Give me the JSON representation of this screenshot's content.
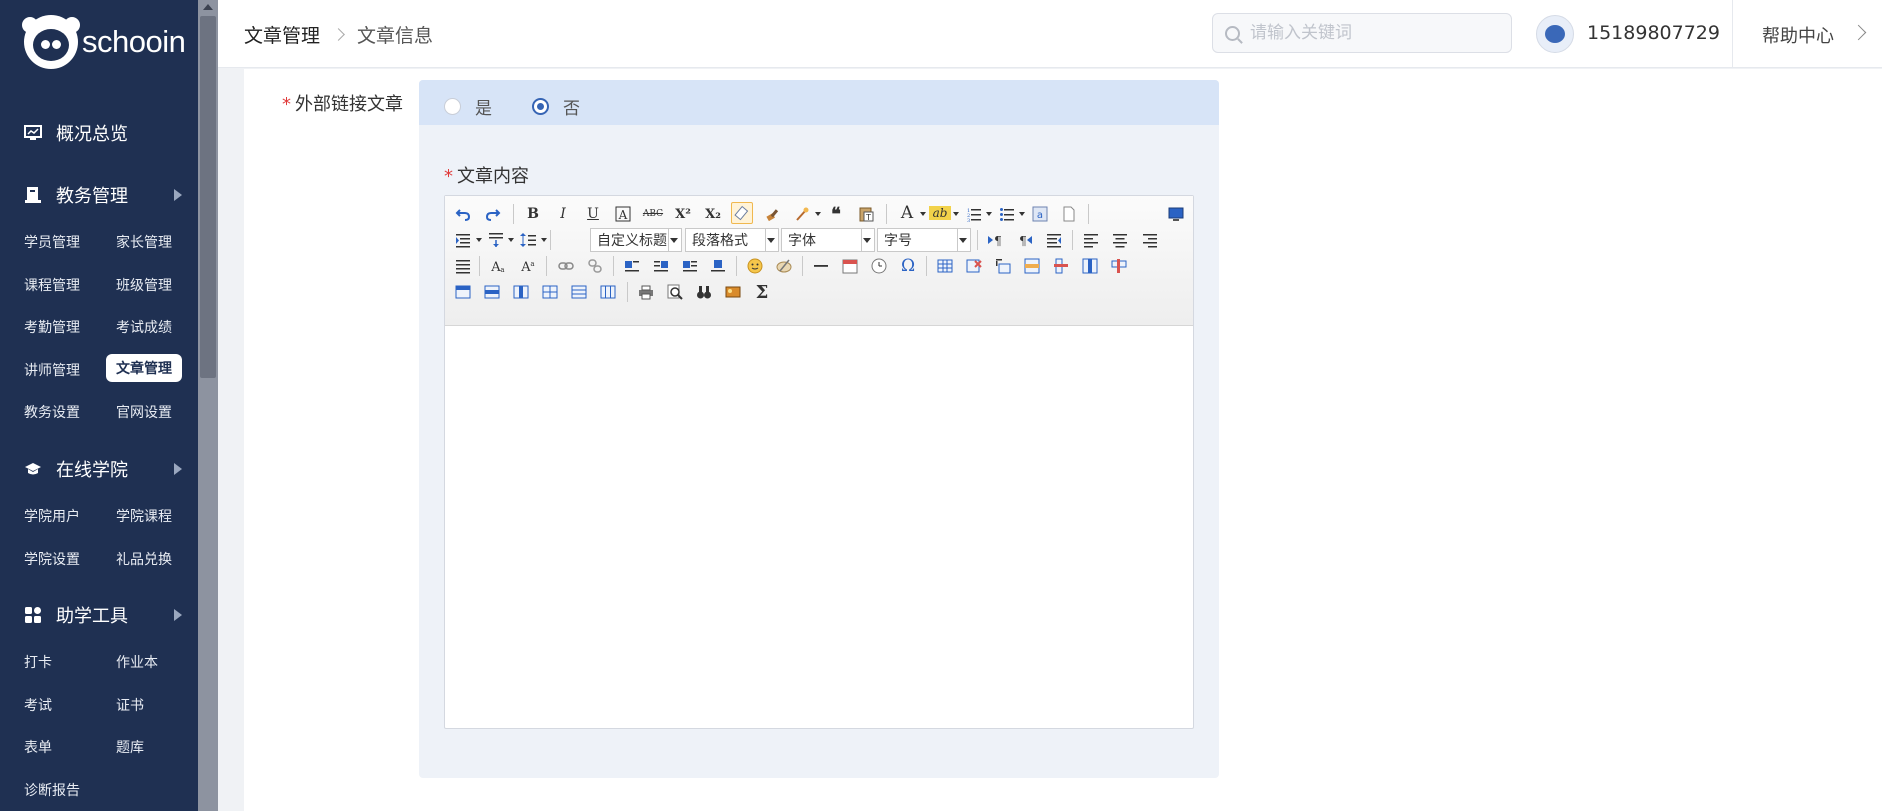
{
  "brand": {
    "name": "schooin"
  },
  "sidebar": {
    "sections": [
      {
        "label": "概况总览",
        "icon": "dashboard-icon"
      },
      {
        "label": "教务管理",
        "icon": "book-icon"
      },
      {
        "label": "在线学院",
        "icon": "graduation-cap-icon"
      },
      {
        "label": "助学工具",
        "icon": "grid-icon"
      }
    ],
    "edu_items": [
      "学员管理",
      "家长管理",
      "课程管理",
      "班级管理",
      "考勤管理",
      "考试成绩",
      "讲师管理",
      "文章管理",
      "教务设置",
      "官网设置"
    ],
    "academy_items": [
      "学院用户",
      "学院课程",
      "学院设置",
      "礼品兑换"
    ],
    "tool_items": [
      "打卡",
      "作业本",
      "考试",
      "证书",
      "表单",
      "题库",
      "诊断报告"
    ],
    "active_item": "文章管理"
  },
  "header": {
    "breadcrumb": [
      "文章管理",
      "文章信息"
    ],
    "search_placeholder": "请输入关键词",
    "phone": "15189807729",
    "help": "帮助中心"
  },
  "form": {
    "external_link": {
      "label": "外部链接文章",
      "options": [
        "是",
        "否"
      ],
      "selected": "否"
    },
    "content_label": "文章内容",
    "required_mark": "*"
  },
  "editor": {
    "dropdowns": {
      "heading": "自定义标题",
      "paragraph": "段落格式",
      "font": "字体",
      "size": "字号"
    },
    "tools_row1": [
      "undo-icon",
      "redo-icon",
      "bold-icon",
      "italic-icon",
      "underline-icon",
      "font-border-icon",
      "strikethrough-icon",
      "superscript-icon",
      "subscript-icon",
      "eraser-icon",
      "format-brush-icon",
      "auto-format-icon",
      "blockquote-icon",
      "paste-text-icon",
      "font-color-icon",
      "highlight-icon",
      "ordered-list-icon",
      "unordered-list-icon",
      "select-all-icon",
      "clear-doc-icon",
      "preview-icon"
    ],
    "glyphs": {
      "bold": "B",
      "italic": "I",
      "underline": "U",
      "strike": "ABC",
      "sup": "X²",
      "sub": "X₂",
      "quote": "❝",
      "fontcolor": "A",
      "omega": "Ω",
      "sigma": "Σ",
      "highlight": "ab"
    },
    "accent": "#3664b4"
  }
}
